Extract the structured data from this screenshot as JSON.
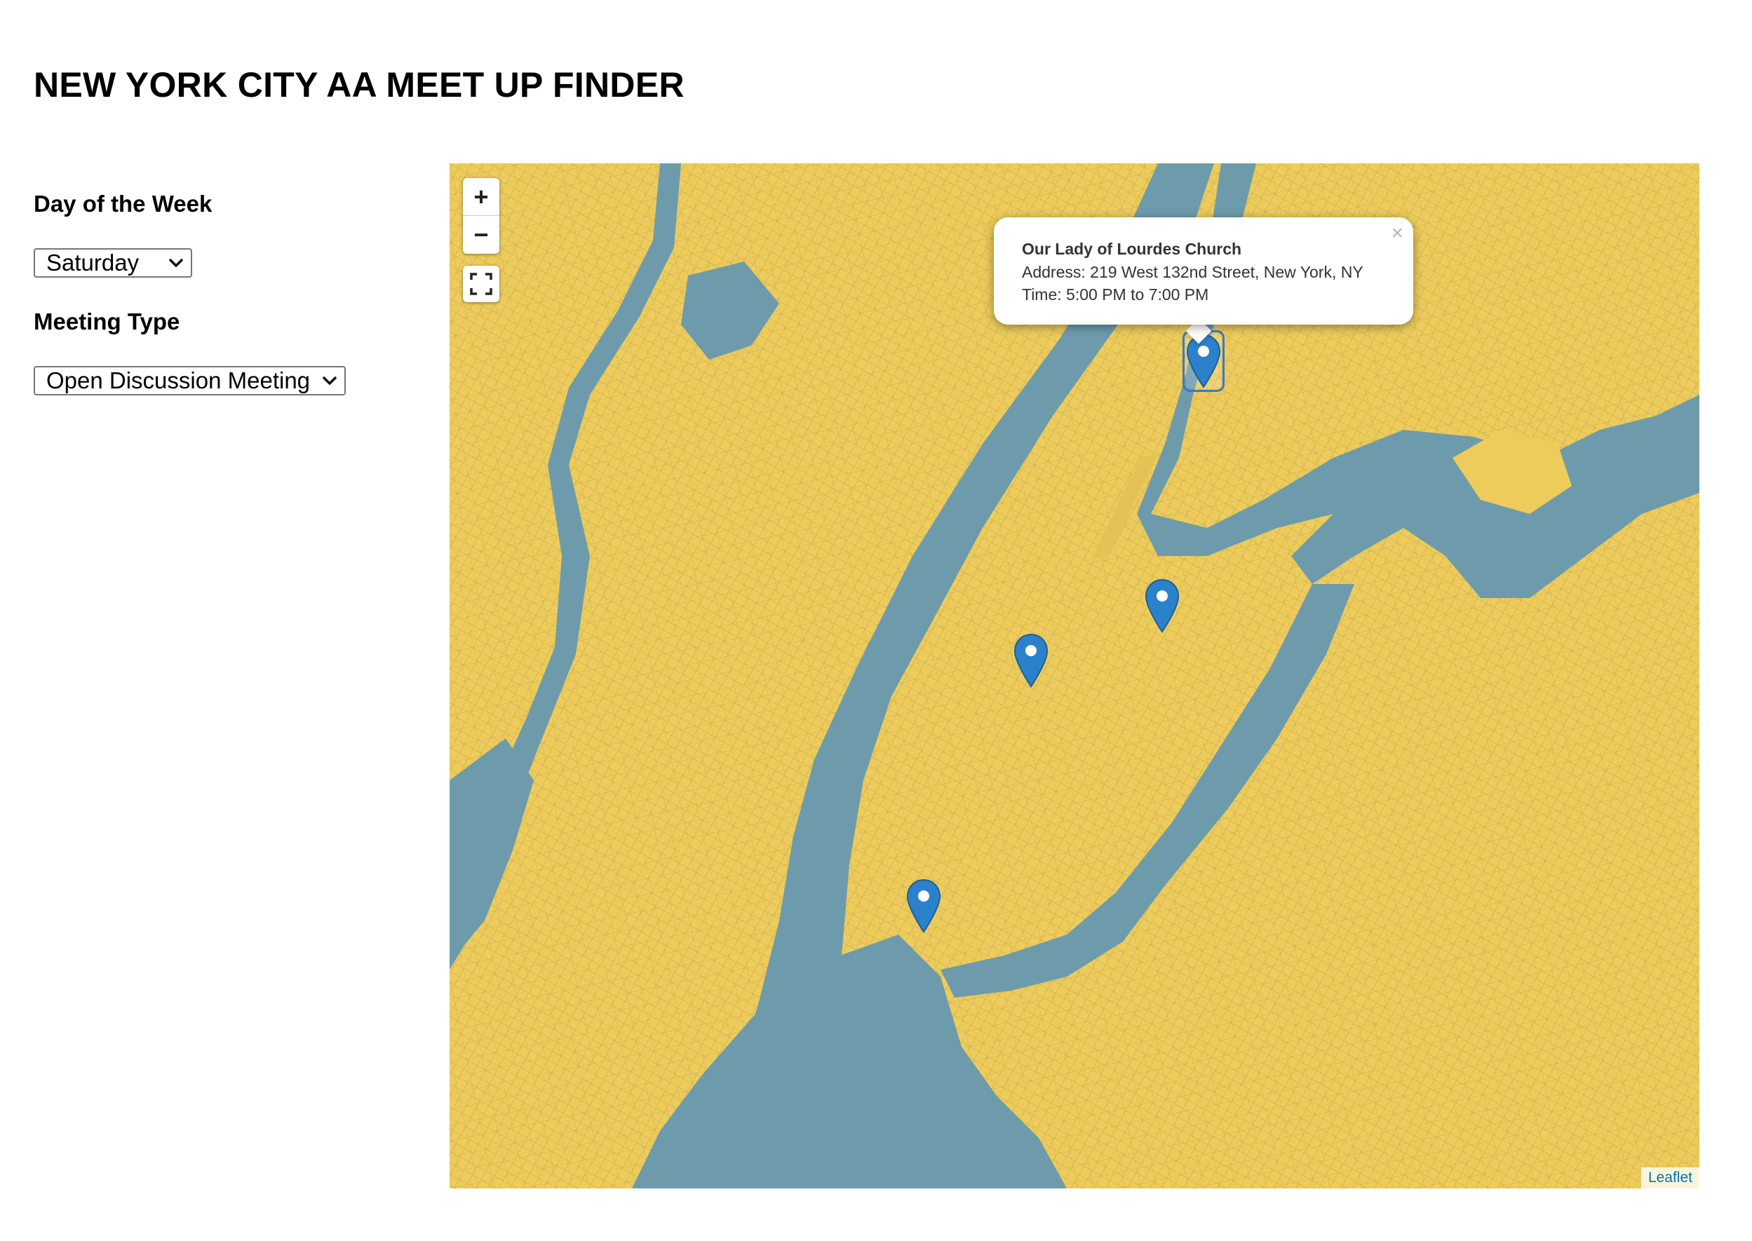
{
  "page": {
    "title": "NEW YORK CITY AA MEET UP FINDER"
  },
  "filters": {
    "day": {
      "label": "Day of the Week",
      "selected": "Saturday"
    },
    "meeting_type": {
      "label": "Meeting Type",
      "selected": "Open Discussion Meeting"
    }
  },
  "map": {
    "zoom_in_label": "+",
    "zoom_out_label": "−",
    "attribution": "Leaflet",
    "colors": {
      "land": "#edcc5c",
      "water": "#6d9bab",
      "marker": "#2b82cb",
      "streets": "#3a3320"
    },
    "popup": {
      "name": "Our Lady of Lourdes Church",
      "address": "Address: 219 West 132nd Street, New York, NY",
      "time": "Time: 5:00 PM to 7:00 PM",
      "close_label": "×"
    },
    "marker_count": 4
  }
}
